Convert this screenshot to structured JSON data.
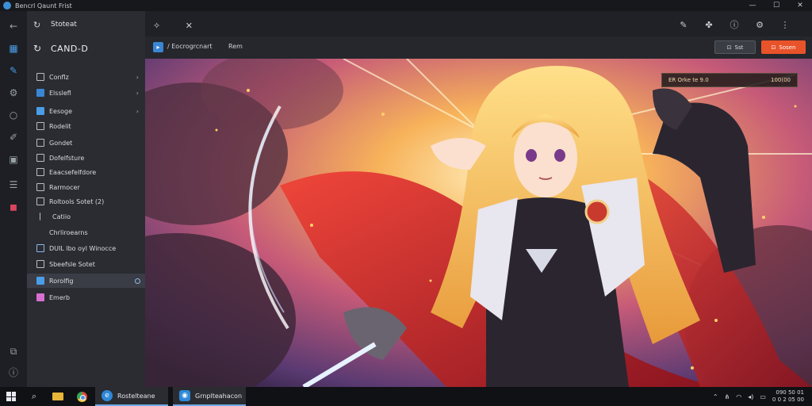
{
  "window": {
    "title": "Bencrl Qaunt Frist"
  },
  "rail": {
    "icons": [
      "back-arrow-icon",
      "calendar-icon",
      "brush-icon",
      "gear-icon",
      "circle-icon",
      "edit-icon",
      "layout-icon",
      "list-icon",
      "bag-icon",
      "layers-icon",
      "info-icon"
    ]
  },
  "sidebar": {
    "header": "Stoteat",
    "title": "CAND-D",
    "items": [
      {
        "label": "Conflz",
        "chevron": "›"
      },
      {
        "label": "Elsslefl",
        "chevron": "›"
      },
      {
        "label": "Eesoge",
        "chevron": "›"
      },
      {
        "label": "Rodelit"
      },
      {
        "label": "Gondet"
      },
      {
        "label": "Dofelfsture"
      },
      {
        "label": "Eaacsefelfdore"
      },
      {
        "label": "Rarmocer"
      },
      {
        "label": "Roltools Sotet (2)"
      },
      {
        "label": "Catiio"
      },
      {
        "label": "Chrliroearns"
      },
      {
        "label": "DUIL lbo oyl Winocce"
      },
      {
        "label": "Sbeefsle Sotet"
      },
      {
        "label": "Rorolfig"
      },
      {
        "label": "Emerb"
      }
    ]
  },
  "tabbar": {
    "close_glyph": "✕"
  },
  "address": {
    "crumb": "/ Eocrogrcnart",
    "crumb2": "Rem",
    "secondary_button": "Sst",
    "primary_button": "Sosen"
  },
  "artwork": {
    "badge_left": "ER Orke te 9.0",
    "badge_right": "100(00"
  },
  "taskbar": {
    "apps": [
      {
        "label": "Rostelteane",
        "glyph": "e"
      },
      {
        "label": "Grnplteahacon",
        "glyph": "◉"
      }
    ],
    "tray_time": "090 50 01",
    "tray_date": "0 0 2 05 00"
  },
  "colors": {
    "accent_orange": "#e8532a",
    "accent_blue": "#3a86d4",
    "sidebar_bg": "#2a2c32",
    "taskbar_bg": "#101114"
  }
}
